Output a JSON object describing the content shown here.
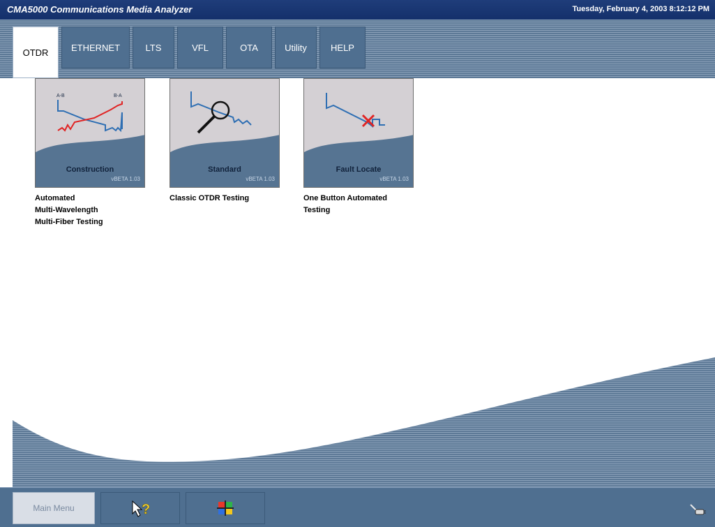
{
  "window": {
    "title": "CMA5000 Communications Media Analyzer",
    "datetime": "Tuesday, February 4, 2003 8:12:12 PM"
  },
  "tabs": [
    {
      "label": "OTDR",
      "active": true
    },
    {
      "label": "ETHERNET",
      "active": false
    },
    {
      "label": "LTS",
      "active": false
    },
    {
      "label": "VFL",
      "active": false
    },
    {
      "label": "OTA",
      "active": false
    },
    {
      "label": "Utility",
      "active": false
    },
    {
      "label": "HELP",
      "active": false
    }
  ],
  "cards": [
    {
      "name": "Construction",
      "version": "vBETA 1.03",
      "description_lines": [
        "Automated",
        "Multi-Wavelength",
        "Multi-Fiber Testing"
      ],
      "labels": [
        "A-B",
        "B-A"
      ],
      "icon": "dual-trace-icon"
    },
    {
      "name": "Standard",
      "version": "vBETA 1.03",
      "description_lines": [
        "Classic OTDR Testing"
      ],
      "icon": "magnifier-trace-icon"
    },
    {
      "name": "Fault Locate",
      "version": "vBETA 1.03",
      "description_lines": [
        "One Button Automated",
        "Testing"
      ],
      "icon": "fault-trace-icon"
    }
  ],
  "bottombar": {
    "main_menu_label": "Main Menu",
    "help_icon": "pointer-question-icon",
    "windows_icon": "windows-flag-icon",
    "tray_icon": "network-plug-icon"
  },
  "colors": {
    "title_bar": "#14306b",
    "accent": "#4f6f90",
    "trace_blue": "#2f6fb3",
    "trace_red": "#e02424"
  }
}
